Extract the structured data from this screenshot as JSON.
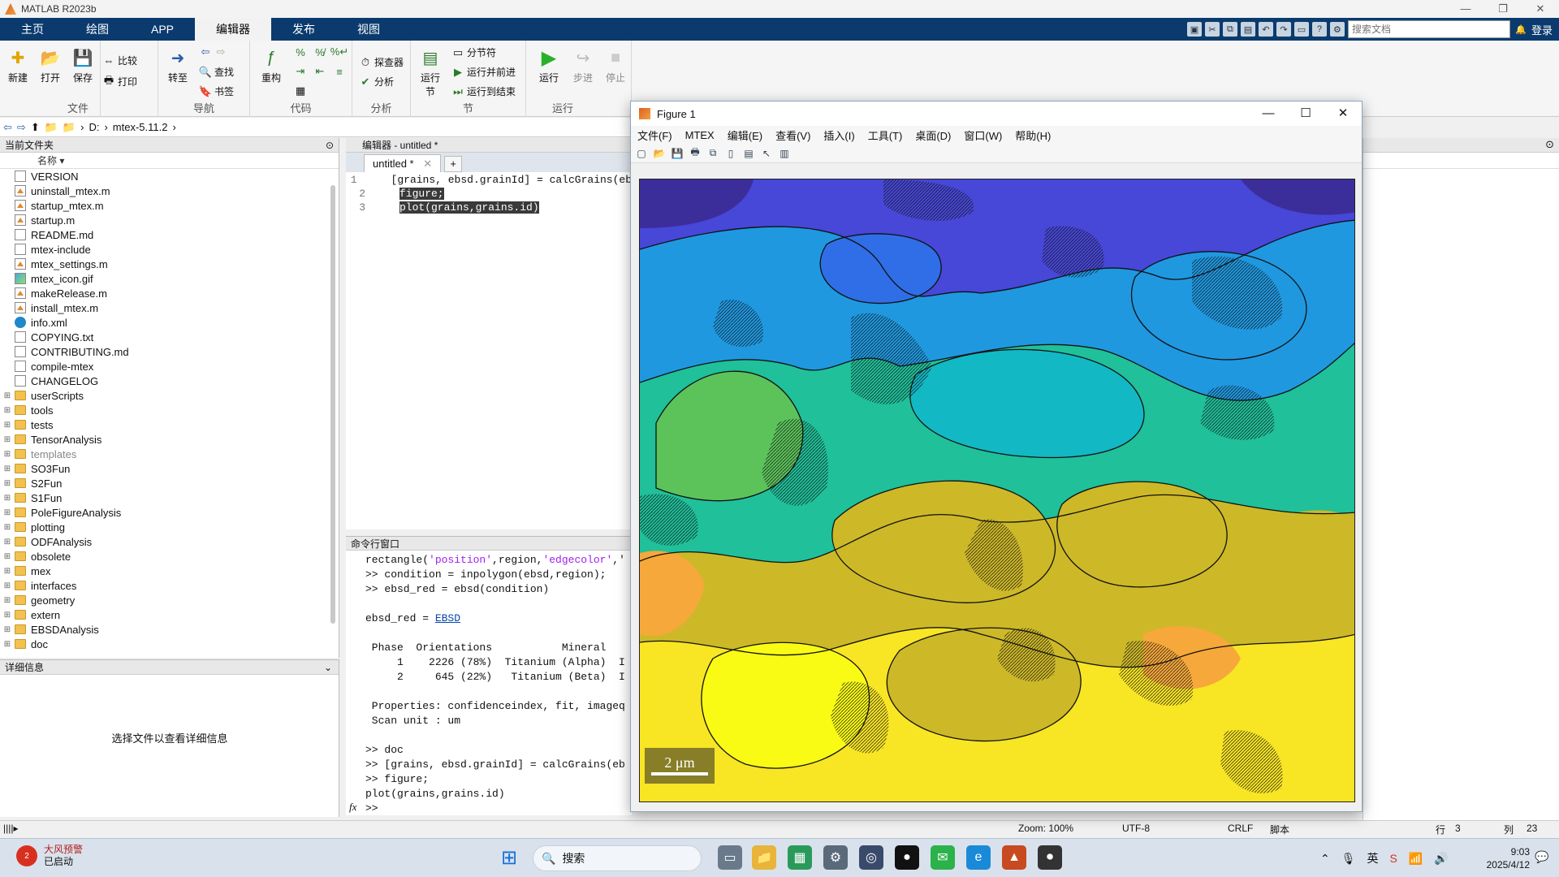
{
  "app": {
    "title": "MATLAB R2023b"
  },
  "window_controls": {
    "min": "—",
    "max": "❐",
    "close": "✕"
  },
  "ribbon_tabs": [
    "主页",
    "绘图",
    "APP",
    "编辑器",
    "发布",
    "视图"
  ],
  "quick": {
    "search_placeholder": "搜索文档",
    "login": "登录"
  },
  "ribbon": {
    "file": {
      "label": "文件",
      "new": "新建",
      "open": "打开",
      "save": "保存",
      "compare": "比较",
      "print": "打印"
    },
    "nav": {
      "label": "导航",
      "goto": "转至",
      "find": "查找",
      "bookmark": "书签"
    },
    "code": {
      "label": "代码",
      "refactor": "重构"
    },
    "analysis": {
      "label": "分析",
      "profiler": "探查器",
      "analyze": "分析"
    },
    "section": {
      "label": "节",
      "run_section": "运行\n节",
      "section_break": "分节符",
      "run_advance": "运行并前进",
      "run_to_end": "运行到结束"
    },
    "run": {
      "label": "运行",
      "run": "运行",
      "step": "步进",
      "stop": "停止"
    }
  },
  "address": {
    "drive": "D:",
    "folder": "mtex-5.11.2"
  },
  "file_panel": {
    "title": "当前文件夹",
    "col": "名称",
    "items": [
      {
        "name": "VERSION",
        "type": "doc"
      },
      {
        "name": "uninstall_mtex.m",
        "type": "mfile"
      },
      {
        "name": "startup_mtex.m",
        "type": "mfile"
      },
      {
        "name": "startup.m",
        "type": "mfile"
      },
      {
        "name": "README.md",
        "type": "doc"
      },
      {
        "name": "mtex-include",
        "type": "doc"
      },
      {
        "name": "mtex_settings.m",
        "type": "mfile"
      },
      {
        "name": "mtex_icon.gif",
        "type": "img"
      },
      {
        "name": "makeRelease.m",
        "type": "mfile"
      },
      {
        "name": "install_mtex.m",
        "type": "mfile"
      },
      {
        "name": "info.xml",
        "type": "xml"
      },
      {
        "name": "COPYING.txt",
        "type": "doc"
      },
      {
        "name": "CONTRIBUTING.md",
        "type": "doc"
      },
      {
        "name": "compile-mtex",
        "type": "doc"
      },
      {
        "name": "CHANGELOG",
        "type": "doc"
      },
      {
        "name": "userScripts",
        "type": "folder"
      },
      {
        "name": "tools",
        "type": "folder"
      },
      {
        "name": "tests",
        "type": "folder"
      },
      {
        "name": "TensorAnalysis",
        "type": "folder"
      },
      {
        "name": "templates",
        "type": "folder"
      },
      {
        "name": "SO3Fun",
        "type": "folder"
      },
      {
        "name": "S2Fun",
        "type": "folder"
      },
      {
        "name": "S1Fun",
        "type": "folder"
      },
      {
        "name": "PoleFigureAnalysis",
        "type": "folder"
      },
      {
        "name": "plotting",
        "type": "folder"
      },
      {
        "name": "ODFAnalysis",
        "type": "folder"
      },
      {
        "name": "obsolete",
        "type": "folder"
      },
      {
        "name": "mex",
        "type": "folder"
      },
      {
        "name": "interfaces",
        "type": "folder"
      },
      {
        "name": "geometry",
        "type": "folder"
      },
      {
        "name": "extern",
        "type": "folder"
      },
      {
        "name": "EBSDAnalysis",
        "type": "folder"
      },
      {
        "name": "doc",
        "type": "folder"
      }
    ]
  },
  "details": {
    "title": "详细信息",
    "hint": "选择文件以查看详细信息"
  },
  "editor": {
    "title": "编辑器 - untitled *",
    "tab": "untitled *",
    "lines": [
      {
        "n": "1",
        "text": "[grains, ebsd.grainId] = calcGrains(eb",
        "sel": false
      },
      {
        "n": "2",
        "text": "figure;",
        "sel": true
      },
      {
        "n": "3",
        "text": "plot(grains,grains.id)",
        "sel": true
      }
    ]
  },
  "command_window": {
    "title": "命令行窗口",
    "lines": [
      "rectangle('position',region,'edgecolor','",
      ">> condition = inpolygon(ebsd,region);",
      ">> ebsd_red = ebsd(condition)",
      "",
      "ebsd_red = EBSD",
      "",
      " Phase  Orientations           Mineral",
      "     1    2226 (78%)  Titanium (Alpha)  I",
      "     2     645 (22%)   Titanium (Beta)  I",
      "",
      " Properties: confidenceindex, fit, imageq",
      " Scan unit : um",
      "",
      ">> doc",
      ">> [grains, ebsd.grainId] = calcGrains(eb",
      ">> figure;",
      "plot(grains,grains.id)",
      ">>"
    ],
    "fx": "fx"
  },
  "figure": {
    "title": "Figure 1",
    "menu": [
      "文件(F)",
      "MTEX",
      "编辑(E)",
      "查看(V)",
      "插入(I)",
      "工具(T)",
      "桌面(D)",
      "窗口(W)",
      "帮助(H)"
    ],
    "scalebar": "2 μm",
    "colors": [
      "#3b2e9a",
      "#4747d8",
      "#2f6ee6",
      "#1f98e0",
      "#12b8c4",
      "#1fc09a",
      "#5cc35a",
      "#a9be32",
      "#cdb828",
      "#f6a83a",
      "#f8e524",
      "#f9fb14"
    ]
  },
  "status": {
    "zoom": "Zoom: 100%",
    "encoding": "UTF-8",
    "eol": "CRLF",
    "type": "脚本",
    "row_label": "行",
    "row": "3",
    "col_label": "列",
    "col": "23"
  },
  "taskbar": {
    "alert": "大风预警",
    "alert_sub": "已启动",
    "search": "搜索",
    "ime": "英",
    "time": "9:03",
    "date": "2025/4/12"
  }
}
